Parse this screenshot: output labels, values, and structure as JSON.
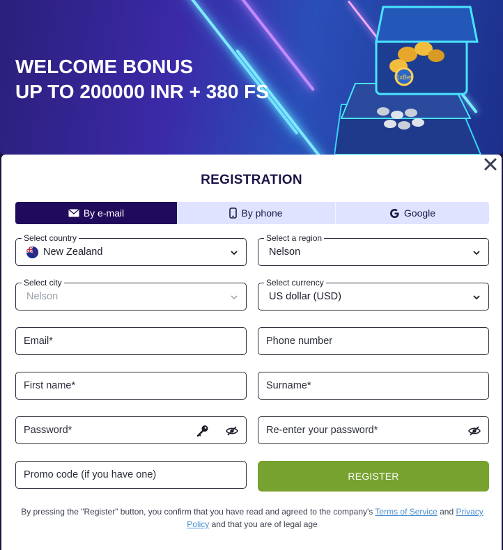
{
  "banner": {
    "line1": "WELCOME BONUS",
    "line2": "UP TO 200000 INR + 380 FS",
    "chest_label": "1xBet"
  },
  "modal": {
    "title": "REGISTRATION",
    "close_icon": "close-icon"
  },
  "tabs": [
    {
      "label": "By e-mail",
      "icon": "envelope-icon",
      "active": true
    },
    {
      "label": "By phone",
      "icon": "phone-icon",
      "active": false
    },
    {
      "label": "Google",
      "icon": "google-icon",
      "active": false
    }
  ],
  "fields": {
    "country": {
      "legend": "Select country",
      "value": "New Zealand"
    },
    "region": {
      "legend": "Select a region",
      "value": "Nelson"
    },
    "city": {
      "legend": "Select city",
      "value": "Nelson"
    },
    "currency": {
      "legend": "Select currency",
      "value": "US dollar (USD)"
    },
    "email": {
      "placeholder": "Email*"
    },
    "phone": {
      "placeholder": "Phone number"
    },
    "first_name": {
      "placeholder": "First name*"
    },
    "surname": {
      "placeholder": "Surname*"
    },
    "password": {
      "placeholder": "Password*"
    },
    "password_repeat": {
      "placeholder": "Re-enter your password*"
    },
    "promo": {
      "placeholder": "Promo code (if you have one)"
    }
  },
  "register_button": "REGISTER",
  "legal": {
    "text_before": "By pressing the \"Register\" button, you confirm that you have read and agreed to the company's ",
    "terms_link": "Terms of Service",
    "and": " and ",
    "privacy_link": "Privacy Policy",
    "text_after": " and that you are of legal age"
  },
  "colors": {
    "active_tab": "#1f0a5c",
    "tab_bg": "#dfe3ff",
    "register": "#78a22f",
    "link": "#4b8fd1",
    "title": "#1b1547"
  }
}
